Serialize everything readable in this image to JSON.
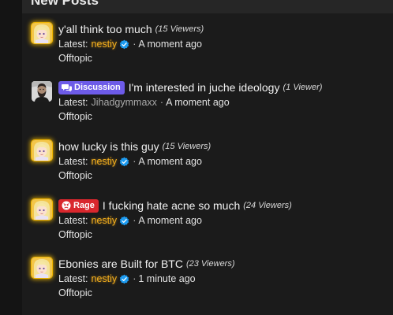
{
  "widget": {
    "title": "New Posts"
  },
  "labels": {
    "latest": "Latest:",
    "separator": "·"
  },
  "colors": {
    "background": "#141414",
    "panel": "#1b1b1b",
    "gold_user": "#f6b01e",
    "verified_badge": "#1d9bf0",
    "discussion_prefix": "#6d5be8",
    "rage_prefix": "#d9272d"
  },
  "posts": [
    {
      "title": "y'all think too much",
      "viewers": "(15 Viewers)",
      "prefix": "",
      "latest_user": "nestiy",
      "user_style": "gold",
      "verified": true,
      "time": "A moment ago",
      "forum": "Offtopic",
      "avatar": "anime-girl-avatar"
    },
    {
      "title": "I'm interested in juche ideology",
      "viewers": "(1 Viewer)",
      "prefix": "Discussion",
      "prefix_icon": "chat-bubbles-icon",
      "latest_user": "Jihadgymmaxx",
      "user_style": "plain",
      "verified": false,
      "time": "A moment ago",
      "forum": "Offtopic",
      "avatar": "bearded-man-avatar"
    },
    {
      "title": "how lucky is this guy",
      "viewers": "(15 Viewers)",
      "prefix": "",
      "latest_user": "nestiy",
      "user_style": "gold",
      "verified": true,
      "time": "A moment ago",
      "forum": "Offtopic",
      "avatar": "anime-girl-avatar"
    },
    {
      "title": "I fucking hate acne so much",
      "viewers": "(24 Viewers)",
      "prefix": "Rage",
      "prefix_icon": "angry-face-icon",
      "latest_user": "nestiy",
      "user_style": "gold",
      "verified": true,
      "time": "A moment ago",
      "forum": "Offtopic",
      "avatar": "anime-girl-avatar"
    },
    {
      "title": "Ebonies are Built for BTC",
      "viewers": "(23 Viewers)",
      "prefix": "",
      "latest_user": "nestiy",
      "user_style": "gold",
      "verified": true,
      "time": "1 minute ago",
      "forum": "Offtopic",
      "avatar": "anime-girl-avatar"
    }
  ]
}
